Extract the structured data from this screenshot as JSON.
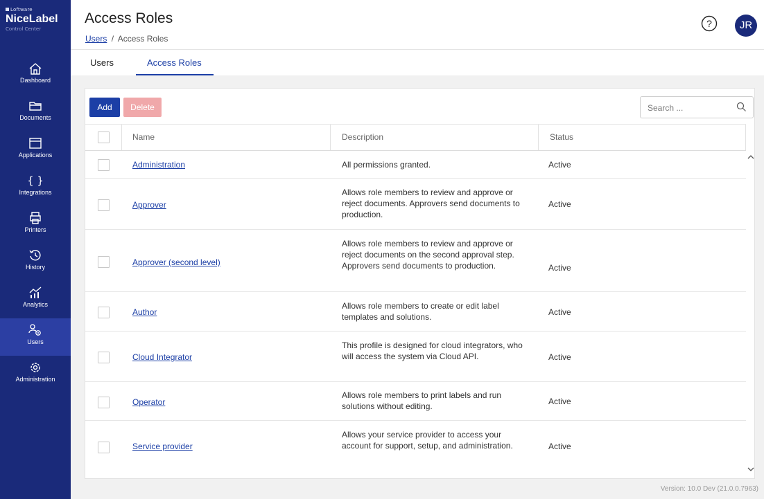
{
  "brand": {
    "vendor": "Loftware",
    "product": "NiceLabel",
    "subtitle": "Control Center"
  },
  "sidebar": {
    "items": [
      {
        "label": "Dashboard",
        "icon": "home-icon"
      },
      {
        "label": "Documents",
        "icon": "folder-icon"
      },
      {
        "label": "Applications",
        "icon": "window-icon"
      },
      {
        "label": "Integrations",
        "icon": "braces-icon"
      },
      {
        "label": "Printers",
        "icon": "printer-icon"
      },
      {
        "label": "History",
        "icon": "history-icon"
      },
      {
        "label": "Analytics",
        "icon": "analytics-icon"
      },
      {
        "label": "Users",
        "icon": "users-gear-icon",
        "active": true
      },
      {
        "label": "Administration",
        "icon": "gear-icon"
      }
    ]
  },
  "header": {
    "title": "Access Roles",
    "breadcrumb": {
      "link": "Users",
      "separator": "/",
      "current": "Access Roles"
    },
    "avatar_initials": "JR"
  },
  "tabs": [
    {
      "label": "Users",
      "active": false
    },
    {
      "label": "Access Roles",
      "active": true
    }
  ],
  "toolbar": {
    "add_label": "Add",
    "delete_label": "Delete",
    "search_placeholder": "Search ..."
  },
  "table": {
    "columns": [
      "Name",
      "Description",
      "Status"
    ],
    "rows": [
      {
        "name": "Administration",
        "description": "All permissions granted.",
        "status": "Active"
      },
      {
        "name": "Approver",
        "description": "Allows role members to review and approve or reject documents. Approvers send documents to production.",
        "status": "Active"
      },
      {
        "name": "Approver (second level)",
        "description": "Allows role members to review and approve or reject documents on the second approval step. Approvers send documents to production.",
        "status": "Active"
      },
      {
        "name": "Author",
        "description": "Allows role members to create or edit label templates and solutions.",
        "status": "Active"
      },
      {
        "name": "Cloud Integrator",
        "description": "This profile is designed for cloud integrators, who will access the system via Cloud API.",
        "status": "Active"
      },
      {
        "name": "Operator",
        "description": "Allows role members to print labels and run solutions without editing.",
        "status": "Active"
      },
      {
        "name": "Service provider",
        "description": "Allows your service provider to access your account for support, setup, and administration.",
        "status": "Active"
      }
    ]
  },
  "footer": {
    "version": "Version: 10.0 Dev (21.0.0.7963)"
  },
  "colors": {
    "sidebar": "#1a2a7a",
    "sidebar_active": "#2c3fa3",
    "accent": "#1c3fa6",
    "delete_disabled": "#f0a8aa"
  }
}
